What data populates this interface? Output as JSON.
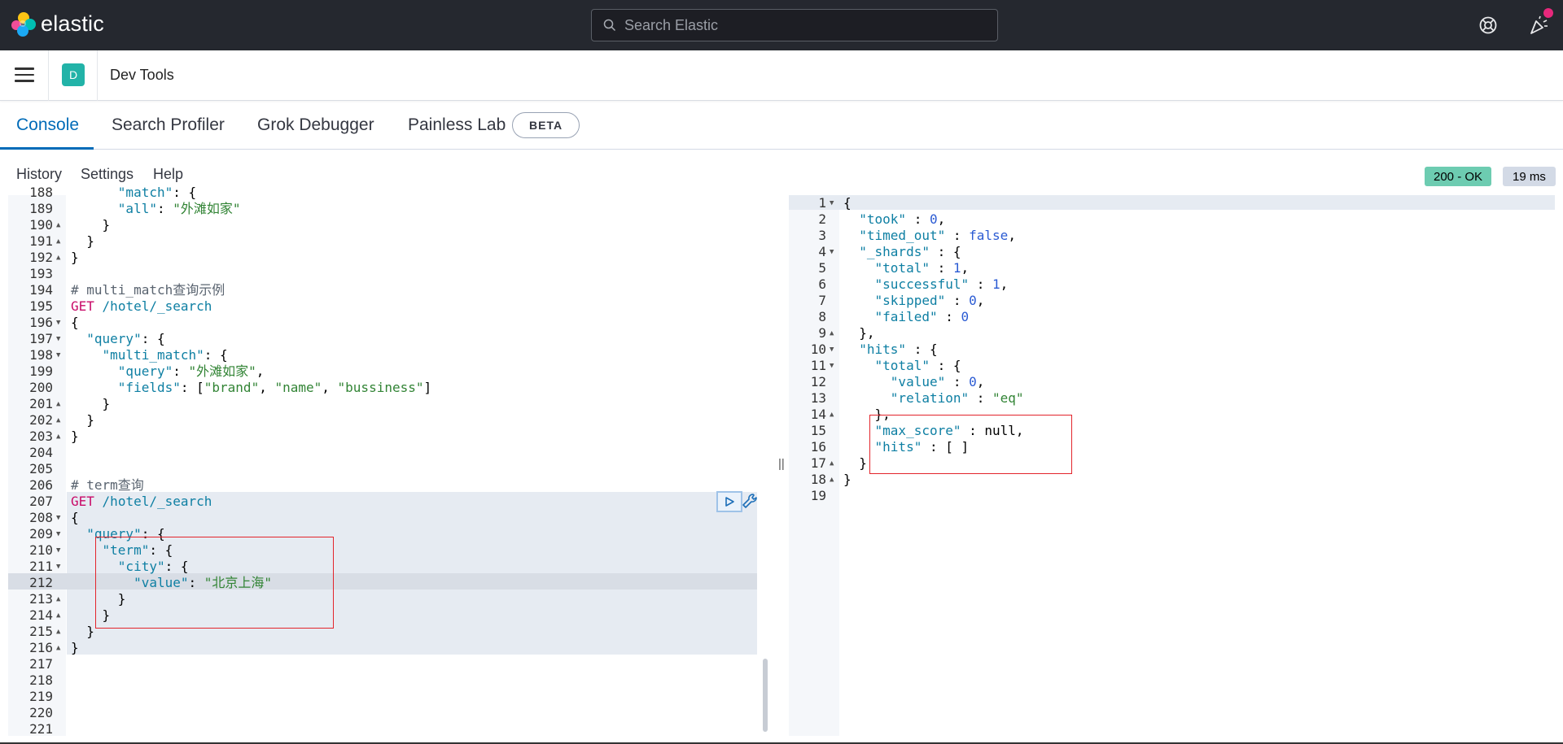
{
  "header": {
    "brand": "elastic",
    "search_placeholder": "Search Elastic"
  },
  "breadcrumb": {
    "space_initial": "D",
    "title": "Dev Tools"
  },
  "tabs": [
    {
      "label": "Console"
    },
    {
      "label": "Search Profiler"
    },
    {
      "label": "Grok Debugger"
    },
    {
      "label": "Painless Lab"
    }
  ],
  "beta_badge": "BETA",
  "toolbar": {
    "history": "History",
    "settings": "Settings",
    "help": "Help",
    "status": "200 - OK",
    "time": "19 ms"
  },
  "request_editor": {
    "lines": [
      {
        "n": "188",
        "fold": "",
        "html": "      <span class='k'>\"match\"</span>: {"
      },
      {
        "n": "189",
        "fold": "",
        "html": "      <span class='k'>\"all\"</span>: <span class='s'>\"外滩如家\"</span>"
      },
      {
        "n": "190",
        "fold": "^",
        "html": "    }"
      },
      {
        "n": "191",
        "fold": "^",
        "html": "  }"
      },
      {
        "n": "192",
        "fold": "^",
        "html": "}"
      },
      {
        "n": "193",
        "fold": "",
        "html": ""
      },
      {
        "n": "194",
        "fold": "",
        "html": "<span class='c'># multi_match查询示例</span>"
      },
      {
        "n": "195",
        "fold": "",
        "html": "<span class='m'>GET</span> <span class='k'>/hotel/_search</span>"
      },
      {
        "n": "196",
        "fold": "v",
        "html": "{"
      },
      {
        "n": "197",
        "fold": "v",
        "html": "  <span class='k'>\"query\"</span>: {"
      },
      {
        "n": "198",
        "fold": "v",
        "html": "    <span class='k'>\"multi_match\"</span>: {"
      },
      {
        "n": "199",
        "fold": "",
        "html": "      <span class='k'>\"query\"</span>: <span class='s'>\"外滩如家\"</span>,"
      },
      {
        "n": "200",
        "fold": "",
        "html": "      <span class='k'>\"fields\"</span>: [<span class='s'>\"brand\"</span>, <span class='s'>\"name\"</span>, <span class='s'>\"bussiness\"</span>]"
      },
      {
        "n": "201",
        "fold": "^",
        "html": "    }"
      },
      {
        "n": "202",
        "fold": "^",
        "html": "  }"
      },
      {
        "n": "203",
        "fold": "^",
        "html": "}"
      },
      {
        "n": "204",
        "fold": "",
        "html": ""
      },
      {
        "n": "205",
        "fold": "",
        "html": ""
      },
      {
        "n": "206",
        "fold": "",
        "html": "<span class='c'># term查询</span>"
      },
      {
        "n": "207",
        "fold": "",
        "html": "<span class='m'>GET</span> <span class='k'>/hotel/_search</span>"
      },
      {
        "n": "208",
        "fold": "v",
        "html": "{"
      },
      {
        "n": "209",
        "fold": "v",
        "html": "  <span class='k'>\"query\"</span>: {"
      },
      {
        "n": "210",
        "fold": "v",
        "html": "    <span class='k'>\"term\"</span>: {"
      },
      {
        "n": "211",
        "fold": "v",
        "html": "      <span class='k'>\"city\"</span>: {"
      },
      {
        "n": "212",
        "fold": "",
        "html": "        <span class='k'>\"value\"</span>: <span class='s'>\"北京上海\"</span>"
      },
      {
        "n": "213",
        "fold": "^",
        "html": "      }"
      },
      {
        "n": "214",
        "fold": "^",
        "html": "    }"
      },
      {
        "n": "215",
        "fold": "^",
        "html": "  }"
      },
      {
        "n": "216",
        "fold": "^",
        "html": "}"
      },
      {
        "n": "217",
        "fold": "",
        "html": ""
      },
      {
        "n": "218",
        "fold": "",
        "html": ""
      },
      {
        "n": "219",
        "fold": "",
        "html": ""
      },
      {
        "n": "220",
        "fold": "",
        "html": ""
      },
      {
        "n": "221",
        "fold": "",
        "html": ""
      }
    ]
  },
  "response_editor": {
    "lines": [
      {
        "n": "1",
        "fold": "v",
        "html": "{"
      },
      {
        "n": "2",
        "fold": "",
        "html": "  <span class='k'>\"took\"</span> : <span class='n'>0</span>,"
      },
      {
        "n": "3",
        "fold": "",
        "html": "  <span class='k'>\"timed_out\"</span> : <span class='n'>false</span>,"
      },
      {
        "n": "4",
        "fold": "v",
        "html": "  <span class='k'>\"_shards\"</span> : {"
      },
      {
        "n": "5",
        "fold": "",
        "html": "    <span class='k'>\"total\"</span> : <span class='n'>1</span>,"
      },
      {
        "n": "6",
        "fold": "",
        "html": "    <span class='k'>\"successful\"</span> : <span class='n'>1</span>,"
      },
      {
        "n": "7",
        "fold": "",
        "html": "    <span class='k'>\"skipped\"</span> : <span class='n'>0</span>,"
      },
      {
        "n": "8",
        "fold": "",
        "html": "    <span class='k'>\"failed\"</span> : <span class='n'>0</span>"
      },
      {
        "n": "9",
        "fold": "^",
        "html": "  },"
      },
      {
        "n": "10",
        "fold": "v",
        "html": "  <span class='k'>\"hits\"</span> : {"
      },
      {
        "n": "11",
        "fold": "v",
        "html": "    <span class='k'>\"total\"</span> : {"
      },
      {
        "n": "12",
        "fold": "",
        "html": "      <span class='k'>\"value\"</span> : <span class='n'>0</span>,"
      },
      {
        "n": "13",
        "fold": "",
        "html": "      <span class='k'>\"relation\"</span> : <span class='s'>\"eq\"</span>"
      },
      {
        "n": "14",
        "fold": "^",
        "html": "    },"
      },
      {
        "n": "15",
        "fold": "",
        "html": "    <span class='k'>\"max_score\"</span> : null,"
      },
      {
        "n": "16",
        "fold": "",
        "html": "    <span class='k'>\"hits\"</span> : [ ]"
      },
      {
        "n": "17",
        "fold": "^",
        "html": "  }"
      },
      {
        "n": "18",
        "fold": "^",
        "html": "}"
      },
      {
        "n": "19",
        "fold": "",
        "html": ""
      }
    ]
  },
  "colors": {
    "header_bg": "#25282f",
    "accent": "#006bb8",
    "status_ok": "#6dccb1",
    "highlight": "#e3242b"
  }
}
